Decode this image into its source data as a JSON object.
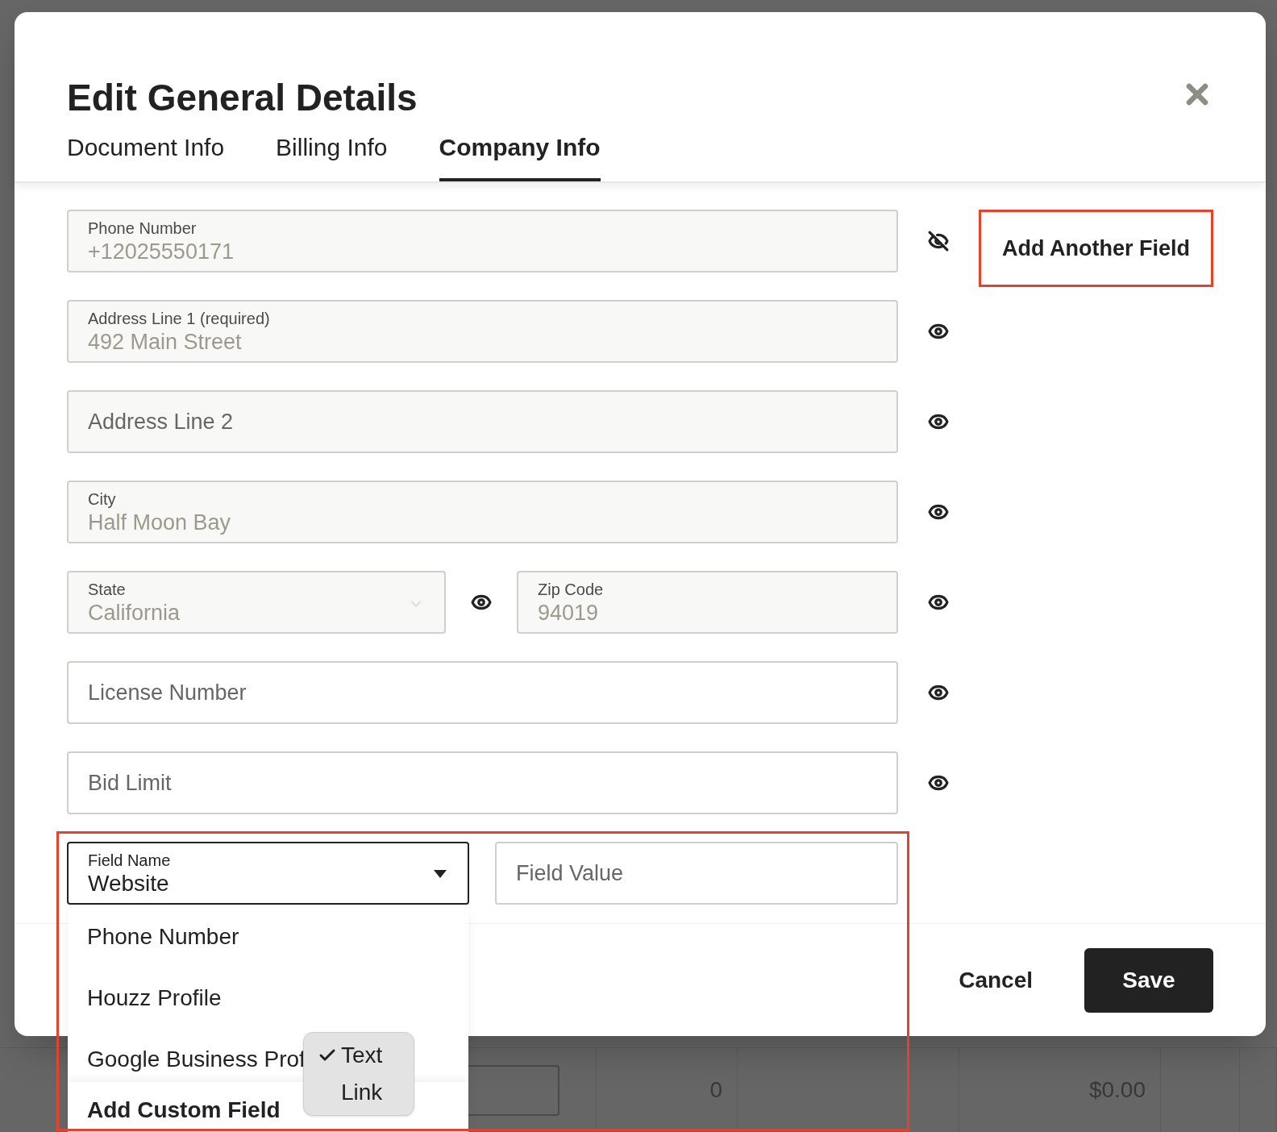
{
  "background_row": {
    "cells": [
      "",
      "0",
      "",
      "$0.00",
      "",
      ""
    ]
  },
  "dialog": {
    "title": "Edit General Details",
    "tabs": [
      {
        "label": "Document Info",
        "selected": false
      },
      {
        "label": "Billing Info",
        "selected": false
      },
      {
        "label": "Company Info",
        "selected": true
      }
    ],
    "fields": [
      {
        "label": "Phone Number",
        "value": "+12025550171",
        "disabled": true,
        "visible": false
      },
      {
        "label": "Address Line 1 (required)",
        "value": "492 Main Street",
        "disabled": true,
        "visible": true
      },
      {
        "placeholder": "Address Line 2",
        "disabled": true,
        "visible": true
      },
      {
        "label": "City",
        "value": "Half Moon Bay",
        "disabled": true,
        "visible": true
      },
      {
        "kind": "pair",
        "left": {
          "label": "State",
          "value": "California",
          "disabled": true,
          "visible": true
        },
        "right": {
          "label": "Zip Code",
          "value": "94019",
          "disabled": true,
          "visible": true
        }
      },
      {
        "placeholder": "License Number",
        "disabled": false,
        "visible": true
      },
      {
        "placeholder": "Bid Limit",
        "disabled": false,
        "visible": true
      }
    ],
    "add_field_button": "Add Another Field",
    "custom_field": {
      "name_label": "Field Name",
      "name_value": "Website",
      "value_placeholder": "Field Value"
    },
    "buttons": {
      "cancel": "Cancel",
      "save": "Save"
    }
  },
  "field_name_menu": {
    "items": [
      "Phone Number",
      "Houzz Profile",
      "Google Business Prof"
    ],
    "footer": "Add Custom Field"
  },
  "type_popover": {
    "options": [
      {
        "label": "Text",
        "checked": true
      },
      {
        "label": "Link",
        "checked": false
      }
    ]
  }
}
